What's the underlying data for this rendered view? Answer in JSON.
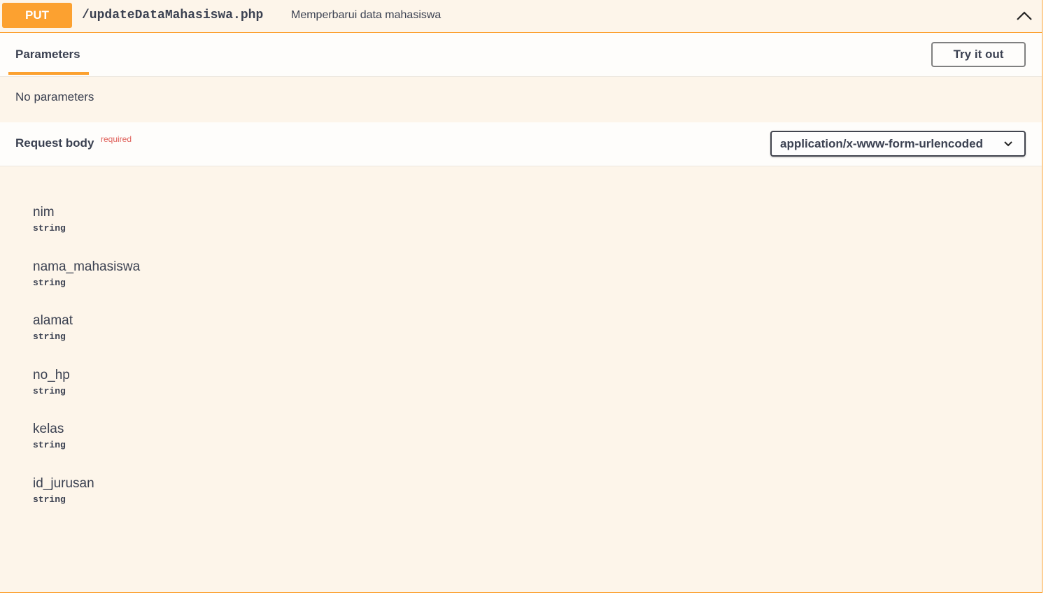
{
  "operation": {
    "method": "PUT",
    "path": "/updateDataMahasiswa.php",
    "summary": "Memperbarui data mahasiswa",
    "accent_color": "#fca130",
    "collapse_icon": "chevron-up-icon"
  },
  "tabs": {
    "parameters_label": "Parameters",
    "try_it_out_label": "Try it out"
  },
  "parameters": {
    "empty_text": "No parameters"
  },
  "request_body": {
    "title": "Request body",
    "required_label": "required",
    "content_type": "application/x-www-form-urlencoded",
    "dropdown_icon": "chevron-down-icon",
    "fields": [
      {
        "name": "nim",
        "type": "string"
      },
      {
        "name": "nama_mahasiswa",
        "type": "string"
      },
      {
        "name": "alamat",
        "type": "string"
      },
      {
        "name": "no_hp",
        "type": "string"
      },
      {
        "name": "kelas",
        "type": "string"
      },
      {
        "name": "id_jurusan",
        "type": "string"
      }
    ]
  }
}
